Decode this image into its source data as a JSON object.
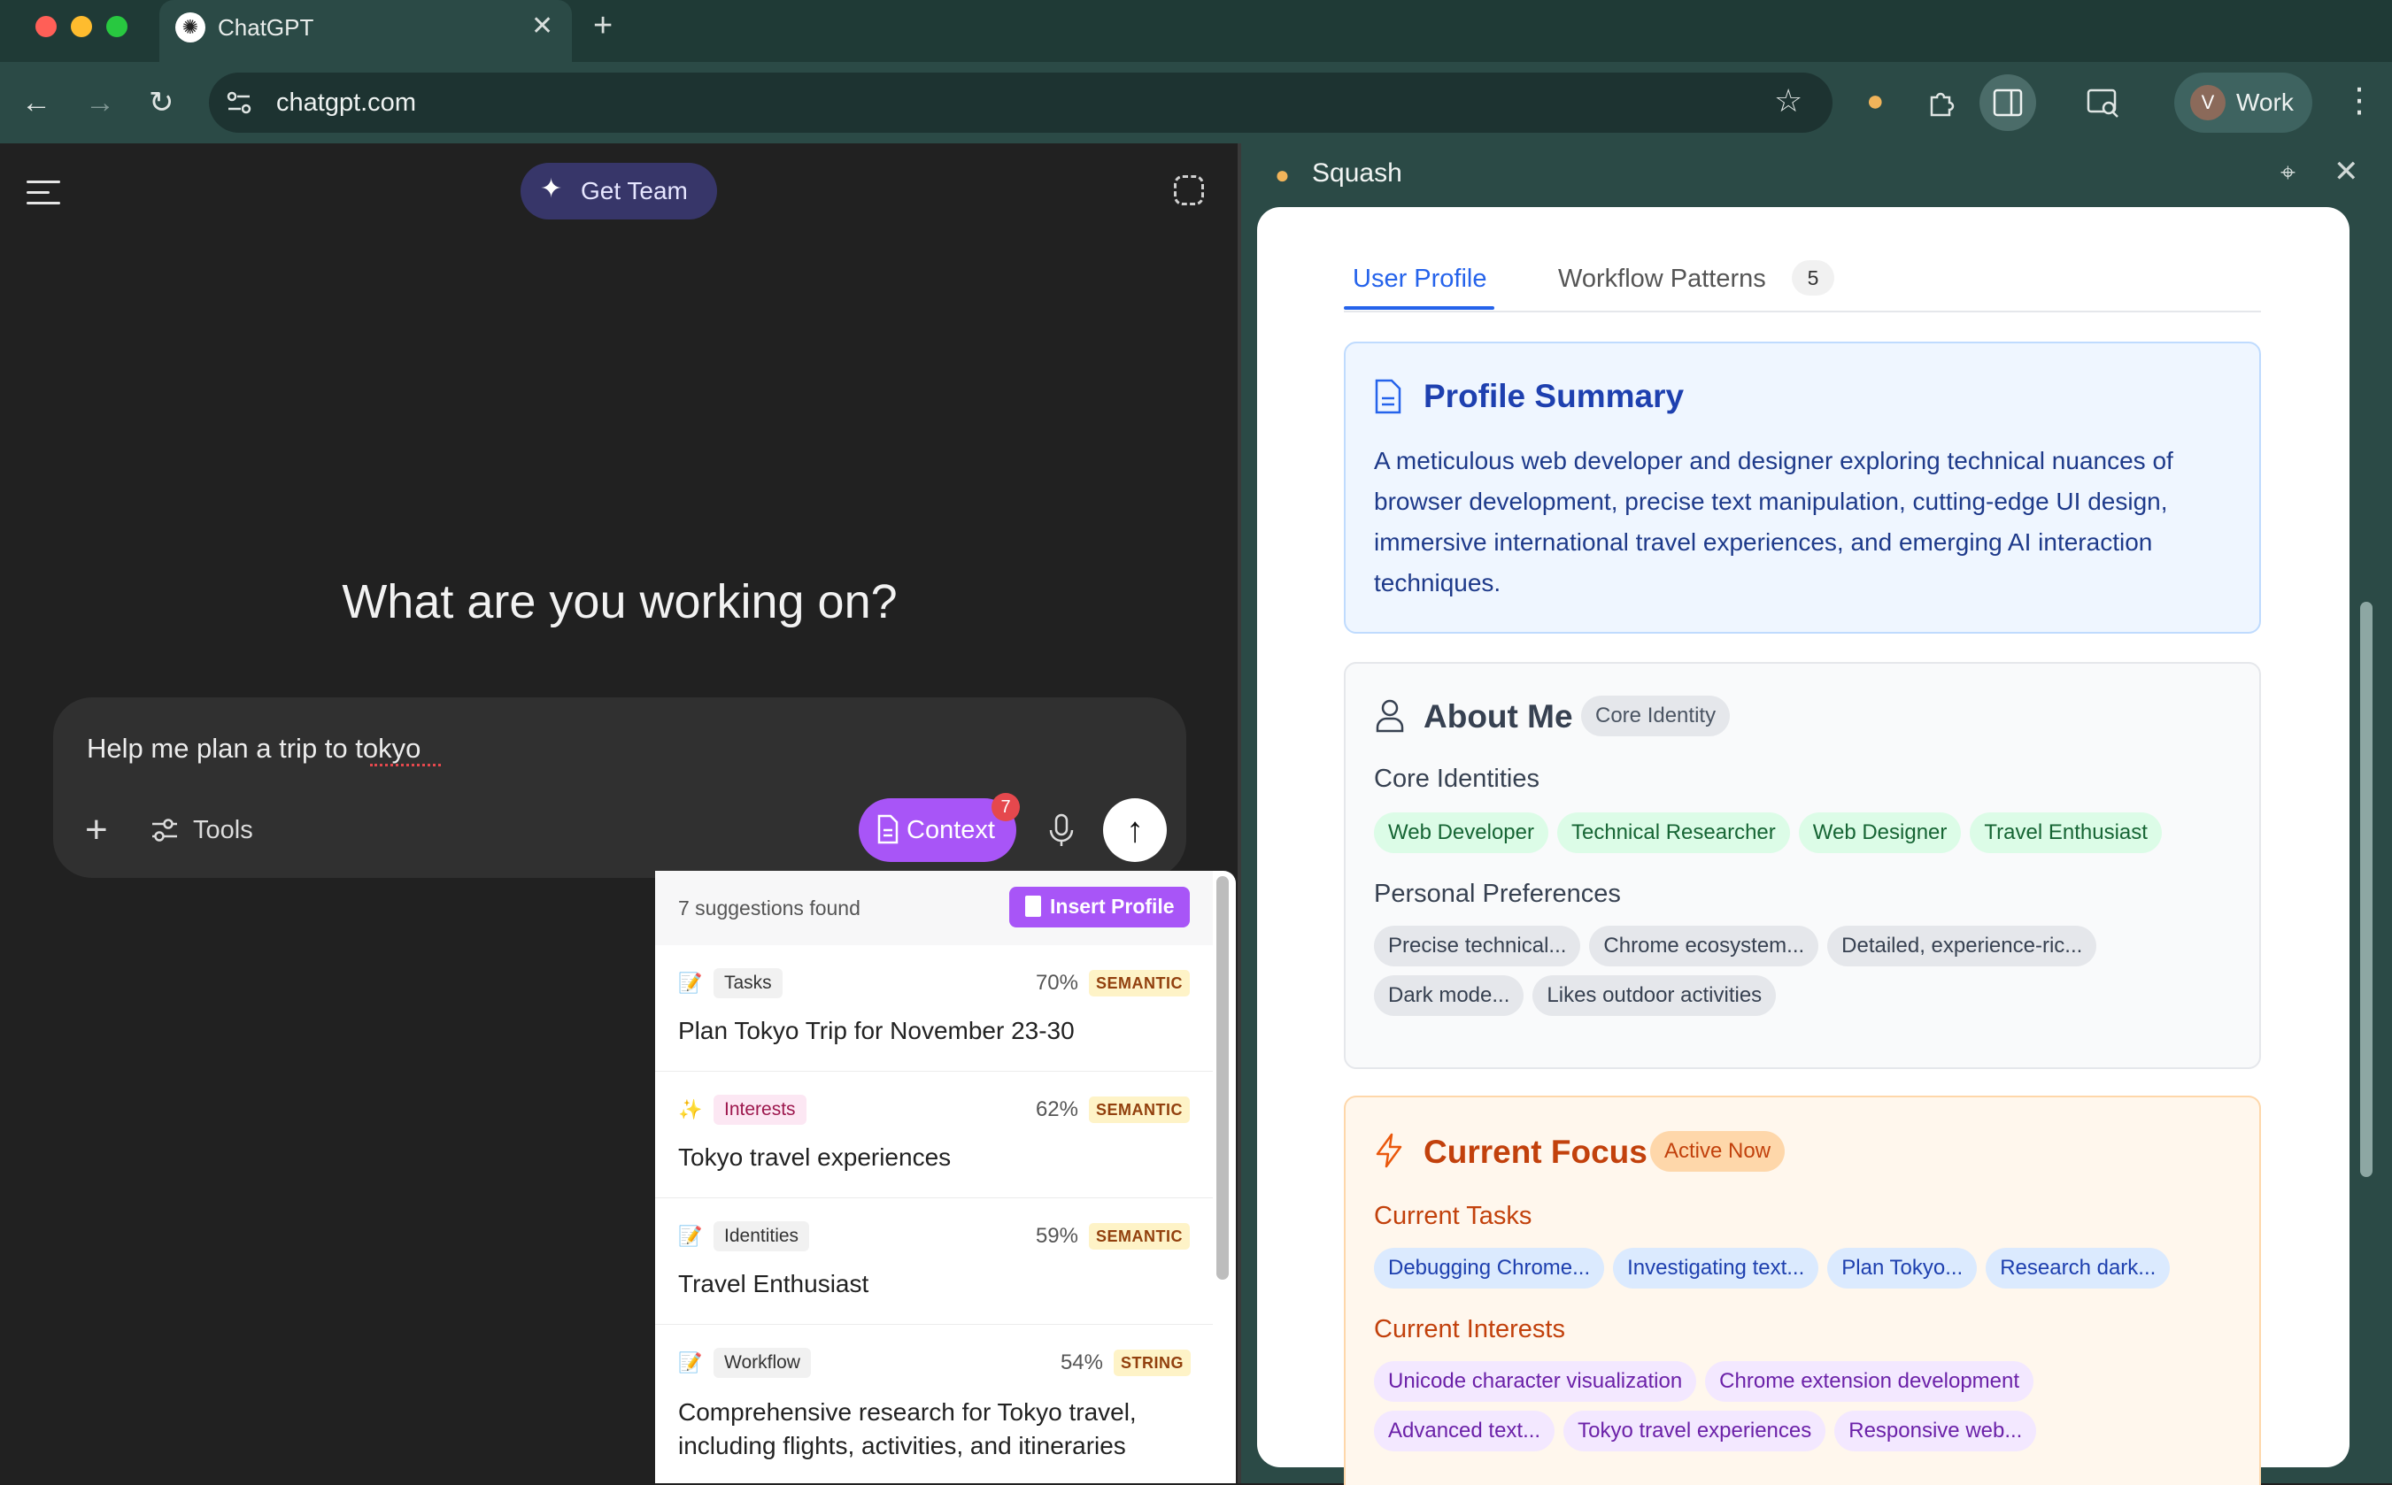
{
  "browser": {
    "tab_title": "ChatGPT",
    "url": "chatgpt.com",
    "profile_initial": "V",
    "profile_name": "Work",
    "colors": {
      "frame": "#1f3a36",
      "toolbar": "#2b4a46"
    }
  },
  "chatgpt": {
    "get_team_label": "Get Team",
    "hero_text": "What are you working on?",
    "prompt_text": "Help me plan a trip to tokyo",
    "tools_label": "Tools",
    "context_label": "Context",
    "context_badge": "7"
  },
  "suggestions": {
    "count_text": "7 suggestions found",
    "insert_label": "Insert Profile",
    "items": [
      {
        "emoji": "📝",
        "category": "Tasks",
        "pct": "70%",
        "type": "SEMANTIC",
        "title": "Plan Tokyo Trip for November 23-30"
      },
      {
        "emoji": "✨",
        "category": "Interests",
        "pct": "62%",
        "type": "SEMANTIC",
        "title": "Tokyo travel experiences"
      },
      {
        "emoji": "📝",
        "category": "Identities",
        "pct": "59%",
        "type": "SEMANTIC",
        "title": "Travel Enthusiast"
      },
      {
        "emoji": "📝",
        "category": "Workflow",
        "pct": "54%",
        "type": "STRING",
        "title": "Comprehensive research for Tokyo travel, including flights, activities, and itineraries"
      }
    ]
  },
  "panel": {
    "title": "Squash",
    "tabs": [
      {
        "label": "User Profile"
      },
      {
        "label": "Workflow Patterns",
        "badge": "5"
      }
    ],
    "profile_summary": {
      "title": "Profile Summary",
      "text": "A meticulous web developer and designer exploring technical nuances of browser development, precise text manipulation, cutting-edge UI design, immersive international travel experiences, and emerging AI interaction techniques."
    },
    "about_me": {
      "title": "About Me",
      "badge": "Core Identity",
      "core_identities_label": "Core Identities",
      "core_identities": [
        "Web Developer",
        "Technical Researcher",
        "Web Designer",
        "Travel Enthusiast"
      ],
      "preferences_label": "Personal Preferences",
      "preferences": [
        "Precise technical...",
        "Chrome ecosystem...",
        "Detailed, experience-ric...",
        "Dark mode...",
        "Likes outdoor activities"
      ]
    },
    "current_focus": {
      "title": "Current Focus",
      "badge": "Active Now",
      "tasks_label": "Current Tasks",
      "tasks": [
        "Debugging Chrome...",
        "Investigating text...",
        "Plan Tokyo...",
        "Research dark..."
      ],
      "interests_label": "Current Interests",
      "interests": [
        "Unicode character visualization",
        "Chrome extension development",
        "Advanced text...",
        "Tokyo travel experiences",
        "Responsive web..."
      ]
    }
  }
}
